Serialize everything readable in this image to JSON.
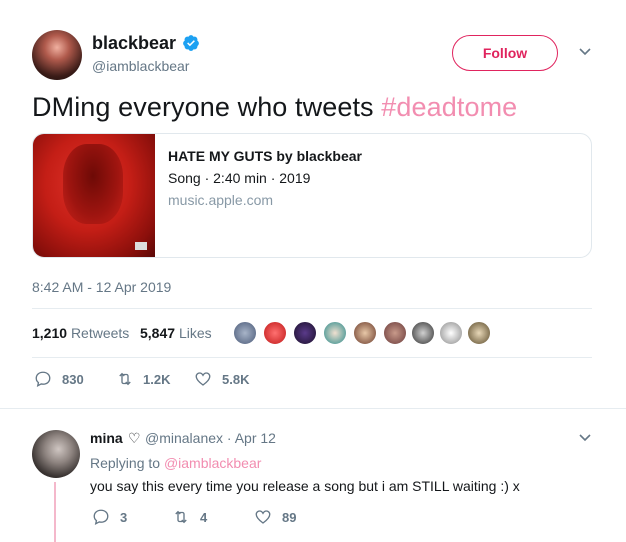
{
  "author": {
    "name": "blackbear",
    "handle": "@iamblackbear",
    "follow_label": "Follow"
  },
  "tweet": {
    "text_prefix": "DMing everyone who tweets ",
    "hashtag": "#deadtome",
    "card": {
      "title": "HATE MY GUTS by blackbear",
      "meta": "Song · 2:40 min · 2019",
      "domain": "music.apple.com"
    },
    "timestamp": "8:42 AM - 12 Apr 2019",
    "stats": {
      "retweets_count": "1,210",
      "retweets_label": "Retweets",
      "likes_count": "5,847",
      "likes_label": "Likes"
    },
    "actions": {
      "replies": "830",
      "retweets": "1.2K",
      "likes": "5.8K"
    }
  },
  "reply": {
    "name": "mina",
    "heart": "♡",
    "handle_date": "@minalanex · Apr 12",
    "replying_prefix": "Replying to ",
    "replying_to": "@iamblackbear",
    "text": "you say this every time you release a song but i am STILL waiting :) x",
    "actions": {
      "replies": "3",
      "retweets": "4",
      "likes": "89"
    }
  },
  "icons": {
    "verified": "verified-badge-icon",
    "chevron": "chevron-down-icon",
    "reply": "reply-icon",
    "retweet": "retweet-icon",
    "like": "heart-icon"
  },
  "colors": {
    "accent_pink": "#e0245e",
    "hashtag_pink": "#f28db0",
    "verified_blue": "#1da1f2",
    "muted_gray": "#657786"
  }
}
